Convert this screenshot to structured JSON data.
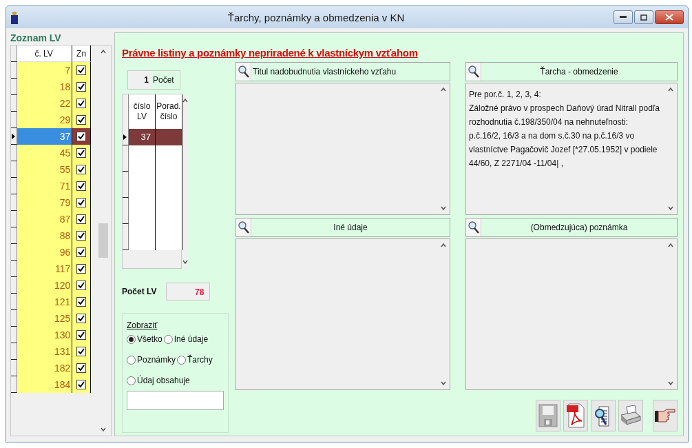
{
  "window": {
    "title": "Ťarchy, poznámky a obmedzenia  v KN"
  },
  "lv_list": {
    "title": "Zoznam LV",
    "columns": [
      "č. LV",
      "Zn"
    ],
    "rows": [
      {
        "lv": "7",
        "checked": true,
        "selected": false
      },
      {
        "lv": "18",
        "checked": true,
        "selected": false
      },
      {
        "lv": "22",
        "checked": true,
        "selected": false
      },
      {
        "lv": "29",
        "checked": true,
        "selected": false
      },
      {
        "lv": "37",
        "checked": true,
        "selected": true
      },
      {
        "lv": "45",
        "checked": true,
        "selected": false
      },
      {
        "lv": "55",
        "checked": true,
        "selected": false
      },
      {
        "lv": "71",
        "checked": true,
        "selected": false
      },
      {
        "lv": "79",
        "checked": true,
        "selected": false
      },
      {
        "lv": "87",
        "checked": true,
        "selected": false
      },
      {
        "lv": "88",
        "checked": true,
        "selected": false
      },
      {
        "lv": "96",
        "checked": true,
        "selected": false
      },
      {
        "lv": "117",
        "checked": true,
        "selected": false
      },
      {
        "lv": "120",
        "checked": true,
        "selected": false
      },
      {
        "lv": "121",
        "checked": true,
        "selected": false
      },
      {
        "lv": "125",
        "checked": true,
        "selected": false
      },
      {
        "lv": "130",
        "checked": true,
        "selected": false
      },
      {
        "lv": "131",
        "checked": true,
        "selected": false
      },
      {
        "lv": "182",
        "checked": true,
        "selected": false
      },
      {
        "lv": "184",
        "checked": true,
        "selected": false
      }
    ]
  },
  "heading": "Právne listiny a poznámky nepriradené k vlastníckym vzťahom",
  "count": {
    "value": "1",
    "label": "Počet"
  },
  "sub_table": {
    "columns": [
      "číslo LV",
      "Porad. číslo"
    ],
    "rows": [
      {
        "cells": [
          "37",
          ""
        ],
        "selected": true
      }
    ]
  },
  "total": {
    "label": "Počet LV",
    "value": "78"
  },
  "filter": {
    "title": "Zobraziť",
    "options": [
      {
        "label": "Všetko",
        "selected": true
      },
      {
        "label": "Iné údaje",
        "selected": false
      },
      {
        "label": "Poznámky",
        "selected": false
      },
      {
        "label": "Ťarchy",
        "selected": false
      },
      {
        "label": "Údaj obsahuje",
        "selected": false
      }
    ]
  },
  "panes": [
    {
      "title": "Titul nadobudnutia vlastníckeho vzťahu"
    },
    {
      "title": "Ťarcha - obmedzenie",
      "text": "Pre por.č. 1, 2, 3, 4:\nZáložné právo v prospech Daňový úrad Nitrall podľa rozhodnutia č.198/350/04 na nehnuteľnosti: p.č.16/2, 16/3 a na dom s.č.30 na p.č.16/3 vo vlastníctve Pagačovič Jozef [*27.05.1952] v podiele 44/60, Z 2271/04 -11/04| ,"
    },
    {
      "title": "Iné údaje"
    },
    {
      "title": "(Obmedzujúca) poznámka"
    }
  ]
}
